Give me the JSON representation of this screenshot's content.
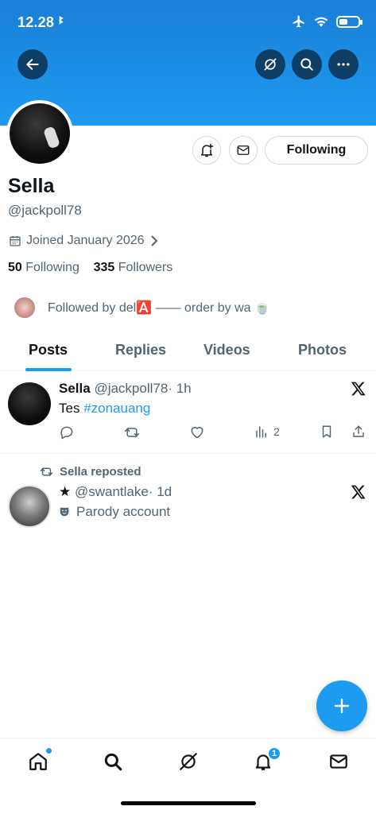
{
  "status": {
    "time": "12.28",
    "extra": "ꔪ"
  },
  "icons": {
    "back": "arrow-left-icon",
    "grok": "grok-icon",
    "search": "search-icon",
    "more": "more-icon",
    "bell_plus": "bell-plus-icon",
    "mail": "mail-icon",
    "calendar": "calendar-icon",
    "chevron": "chevron-right-icon",
    "x_logo": "x-logo-icon",
    "reply": "reply-icon",
    "retweet": "retweet-icon",
    "like": "heart-icon",
    "views": "views-icon",
    "bookmark": "bookmark-icon",
    "share": "share-icon",
    "home": "home-icon",
    "notifications": "bell-icon",
    "messages": "envelope-icon",
    "plus": "plus-icon"
  },
  "colors": {
    "brand": "#1d9bf0",
    "text": "#0f1419",
    "muted": "#536471"
  },
  "profile": {
    "follow_button": "Following",
    "name": "Sella",
    "handle": "@jackpoll78",
    "joined": "Joined January 2026",
    "following_count": "50",
    "following_label": "Following",
    "followers_count": "335",
    "followers_label": "Followers",
    "followed_by": "Followed by del🅰️ —— order by wa 🍵"
  },
  "tabs": [
    "Posts",
    "Replies",
    "Videos",
    "Photos"
  ],
  "posts": [
    {
      "name": "Sella",
      "handle": "@jackpoll78",
      "time": "· 1h",
      "text": "Tes ",
      "hashtag": "#zonauang",
      "views": "2"
    },
    {
      "repost_label": "Sella reposted",
      "star": "★",
      "handle": "@swantlake",
      "time": "· 1d",
      "parody": "Parody account"
    }
  ],
  "nav": {
    "notification_badge": "1"
  }
}
